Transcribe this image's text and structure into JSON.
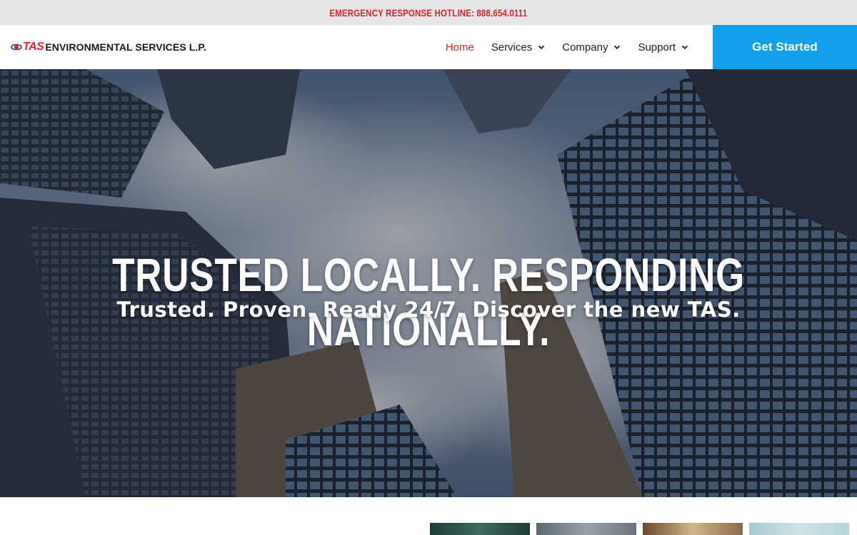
{
  "hotline": {
    "text": "EMERGENCY RESPONSE HOTLINE: 888.654.0111"
  },
  "header": {
    "logo": {
      "tas": "TAS",
      "rest": "ENVIRONMENTAL SERVICES L.P."
    },
    "nav": [
      {
        "label": "Home",
        "active": true
      },
      {
        "label": "Services",
        "has_dropdown": true
      },
      {
        "label": "Company",
        "has_dropdown": true
      },
      {
        "label": "Support",
        "has_dropdown": true
      }
    ],
    "cta_label": "Get Started"
  },
  "hero": {
    "title": "TRUSTED LOCALLY. RESPONDING NATIONALLY.",
    "subtitle": "Trusted. Proven. Ready 24/7. Discover the new TAS."
  },
  "colors": {
    "accent_red": "#e0242c",
    "cta_blue": "#12a0ea",
    "topbar_gray": "#e6e6e6"
  }
}
